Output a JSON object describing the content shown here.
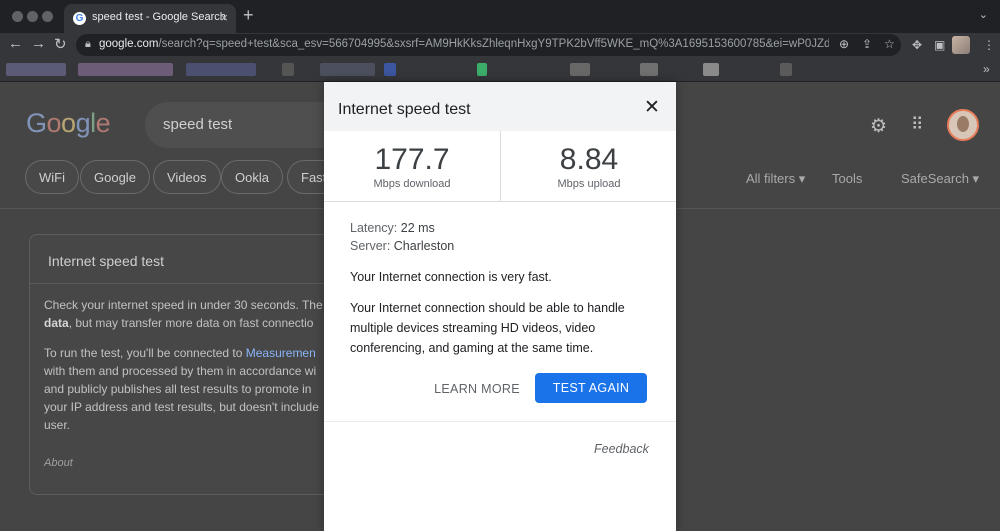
{
  "browser": {
    "tab_title": "speed test - Google Search",
    "tab_close": "×",
    "new_tab": "+",
    "tab_menu": "⌄",
    "url_domain": "google.com",
    "url_path": "/search?q=speed+test&sca_esv=566704995&sxsrf=AM9HkKksZhleqnHxgY9TPK2bVff5WKE_mQ%3A1695153600785&ei=wP0JZdCnL8elqtsP...",
    "bookmarks_overflow": "»"
  },
  "google": {
    "logo": "Google",
    "search_query": "speed test",
    "chips": [
      "WiFi",
      "Google",
      "Videos",
      "Ookla",
      "Fast"
    ],
    "all_filters": "All filters ▾",
    "tools": "Tools",
    "safesearch": "SafeSearch ▾"
  },
  "card": {
    "title": "Internet speed test",
    "line1": "Check your internet speed in under 30 seconds. The",
    "line2_bold": "data",
    "line2_rest": ", but may transfer more data on fast connectio",
    "line3_pre": "To run the test, you'll be connected to ",
    "line3_link": "Measuremen",
    "line4": "with them and processed by them in accordance wi",
    "line5": "and publicly publishes all test results to promote in",
    "line6": "your IP address and test results, but doesn't include",
    "line7": "user.",
    "about": "About"
  },
  "modal": {
    "title": "Internet speed test",
    "close_glyph": "✕",
    "download_value": "177.7",
    "download_unit": "Mbps download",
    "upload_value": "8.84",
    "upload_unit": "Mbps upload",
    "latency_label": "Latency:",
    "latency_value": "22 ms",
    "server_label": "Server:",
    "server_value": "Charleston",
    "summary": "Your Internet connection is very fast.",
    "description": "Your Internet connection should be able to handle multiple devices streaming HD videos, video conferencing, and gaming at the same time.",
    "learn_more": "LEARN MORE",
    "test_again": "TEST AGAIN",
    "feedback": "Feedback"
  },
  "colors": {
    "primary_button": "#1a73e8",
    "overlay_page": "#454545",
    "chrome_dark": "#202124"
  },
  "icons": [
    "back-arrow-icon",
    "forward-arrow-icon",
    "reload-icon",
    "lock-icon",
    "zoom-icon",
    "share-icon",
    "bookmark-star-icon",
    "extensions-icon",
    "sidebar-icon",
    "kebab-menu-icon",
    "settings-gear-icon",
    "apps-grid-icon",
    "close-icon"
  ]
}
